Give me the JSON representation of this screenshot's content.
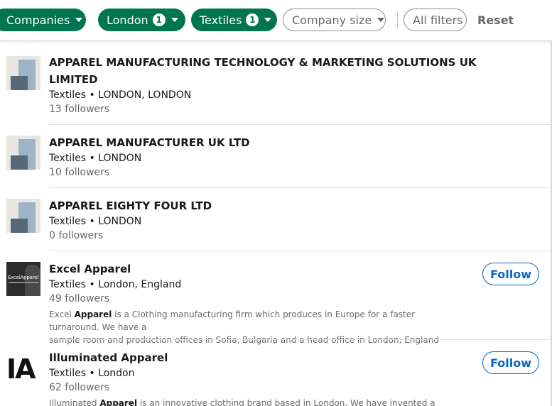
{
  "filters": {
    "companies": "Companies",
    "location": {
      "label": "London",
      "count": "1"
    },
    "industry": {
      "label": "Textiles",
      "count": "1"
    },
    "company_size": "Company size",
    "all_filters": "All filters",
    "reset": "Reset"
  },
  "results": [
    {
      "name_line1": "APPAREL MANUFACTURING TECHNOLOGY & MARKETING SOLUTIONS UK",
      "name_line2": "LIMITED",
      "meta": "Textiles • LONDON, LONDON",
      "followers": "13 followers"
    },
    {
      "name": "APPAREL MANUFACTURER UK LTD",
      "meta": "Textiles • LONDON",
      "followers": "10 followers"
    },
    {
      "name": "APPAREL EIGHTY FOUR LTD",
      "meta": "Textiles • LONDON",
      "followers": "0 followers"
    },
    {
      "name": "Excel Apparel",
      "meta": "Textiles • London, England",
      "followers": "49 followers",
      "logo_text": "ExcelApparel",
      "desc_pre": "Excel ",
      "desc_bold": "Apparel",
      "desc_post1": " is a Clothing manufacturing firm which produces in Europe for a faster turnaround. We have a",
      "desc_line2": "sample room and production offices in Sofia, Bulgaria and a head office in London, England",
      "follow": "Follow"
    },
    {
      "name": "Illuminated Apparel",
      "meta": "Textiles • London",
      "followers": "62 followers",
      "logo_text": "IA",
      "desc_pre": "Illuminated ",
      "desc_bold": "Apparel",
      "desc_post1": " is an innovative clothing brand based in London. We have invented a bespoke",
      "follow": "Follow"
    }
  ],
  "colors": {
    "active_filter": "#01754f",
    "follow_blue": "#0a66c2"
  }
}
